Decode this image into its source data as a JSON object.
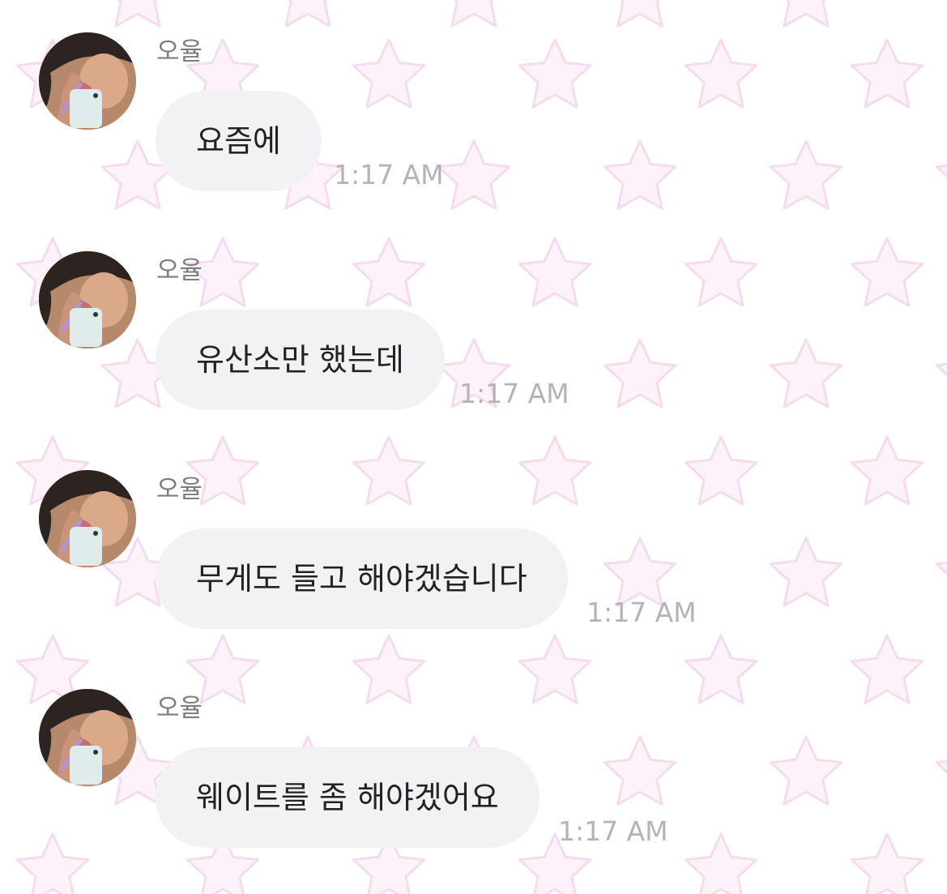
{
  "conversation": {
    "messages": [
      {
        "sender": "오율",
        "text": "요즘에",
        "time": "1:17 AM"
      },
      {
        "sender": "오율",
        "text": "유산소만 했는데",
        "time": "1:17 AM"
      },
      {
        "sender": "오율",
        "text": "무게도 들고 해야겠습니다",
        "time": "1:17 AM"
      },
      {
        "sender": "오율",
        "text": "웨이트를 좀 해야겠어요",
        "time": "1:17 AM"
      }
    ]
  },
  "theme": {
    "background": "#ffffff",
    "star_fill": "#fdf2f9",
    "star_stroke": "#f3dcec",
    "bubble": "#f2f2f5",
    "message_text": "#222222",
    "sender_text": "#7d7d7d",
    "time_text": "#b3b3b8"
  }
}
